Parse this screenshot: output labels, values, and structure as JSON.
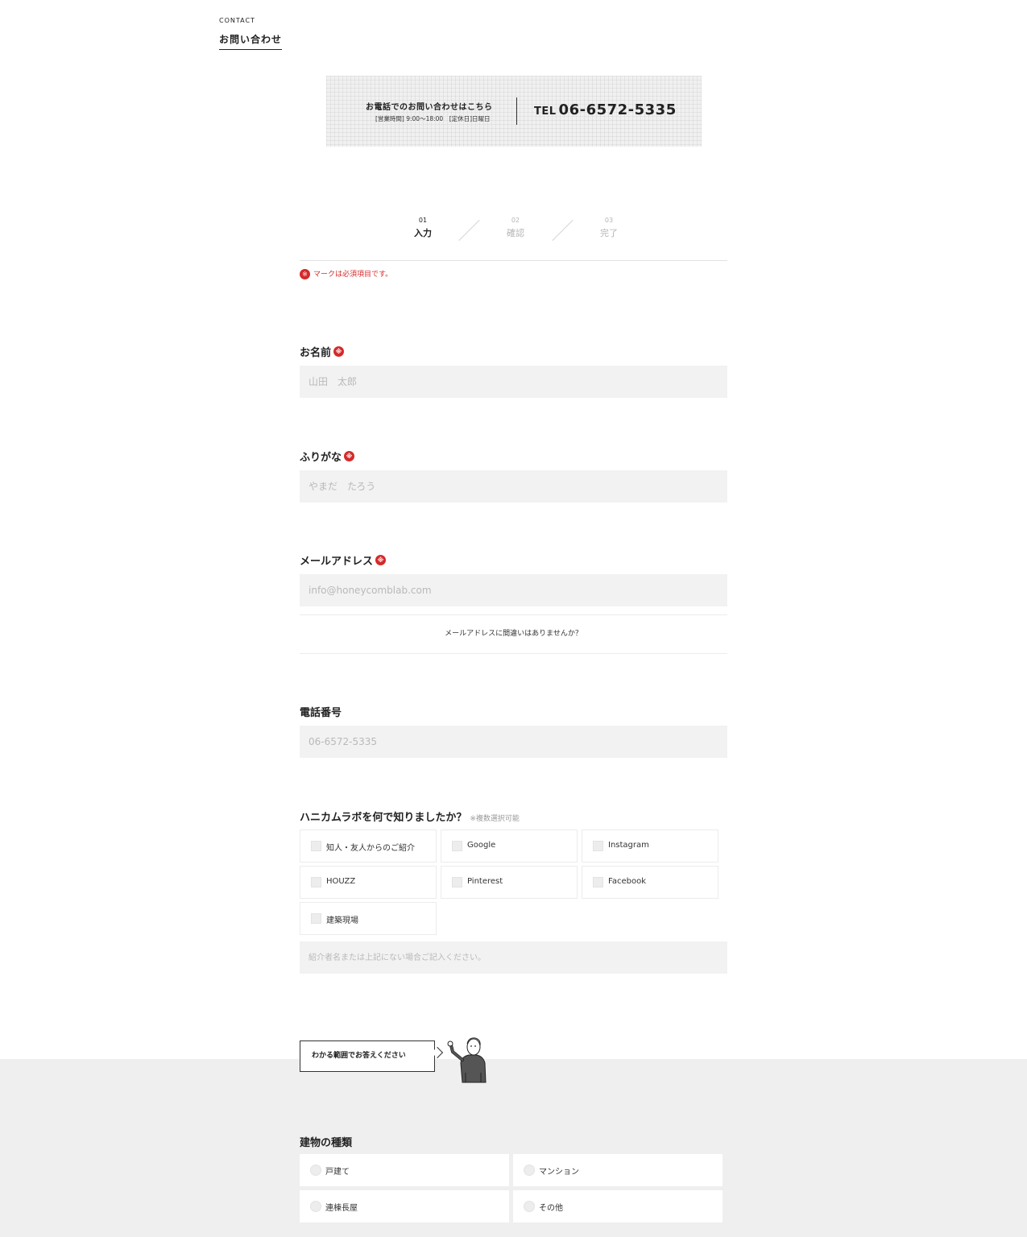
{
  "header": {
    "eyebrow": "CONTACT",
    "title": "お問い合わせ"
  },
  "phone": {
    "lead": "お電話でのお問い合わせはこちら",
    "hours": "[営業時間] 9:00〜18:00　[定休日]日曜日",
    "tel_prefix": "TEL",
    "tel_number": "06-6572-5335"
  },
  "steps": [
    {
      "num": "01",
      "label": "入力"
    },
    {
      "num": "02",
      "label": "確認"
    },
    {
      "num": "03",
      "label": "完了"
    }
  ],
  "required_mark": "※",
  "required_note": "マークは必須項目です。",
  "form": {
    "name": {
      "label": "お名前",
      "placeholder": "山田　太郎"
    },
    "kana": {
      "label": "ふりがな",
      "placeholder": "やまだ　たろう"
    },
    "email": {
      "label": "メールアドレス",
      "placeholder": "info@honeycomblab.com",
      "confirm_text": "メールアドレスに間違いはありませんか？"
    },
    "phone": {
      "label": "電話番号",
      "placeholder": "06-6572-5335"
    },
    "source": {
      "label": "ハニカムラボを何で知りましたか？",
      "note": "※複数選択可能",
      "options": [
        "知人・友人からのご紹介",
        "Google",
        "Instagram",
        "HOUZZ",
        "Pinterest",
        "Facebook",
        "建築現場"
      ],
      "referral_placeholder": "紹介者名または上記にない場合ご記入ください。"
    },
    "speech_bubble": "わかる範囲でお答えください",
    "building": {
      "label": "建物の種類",
      "options": [
        "戸建て",
        "マンション",
        "連棟長屋",
        "その他"
      ]
    }
  },
  "colors": {
    "accent_red": "#d42a2a",
    "input_bg": "#f2f2f2",
    "section_bg": "#efefef"
  }
}
